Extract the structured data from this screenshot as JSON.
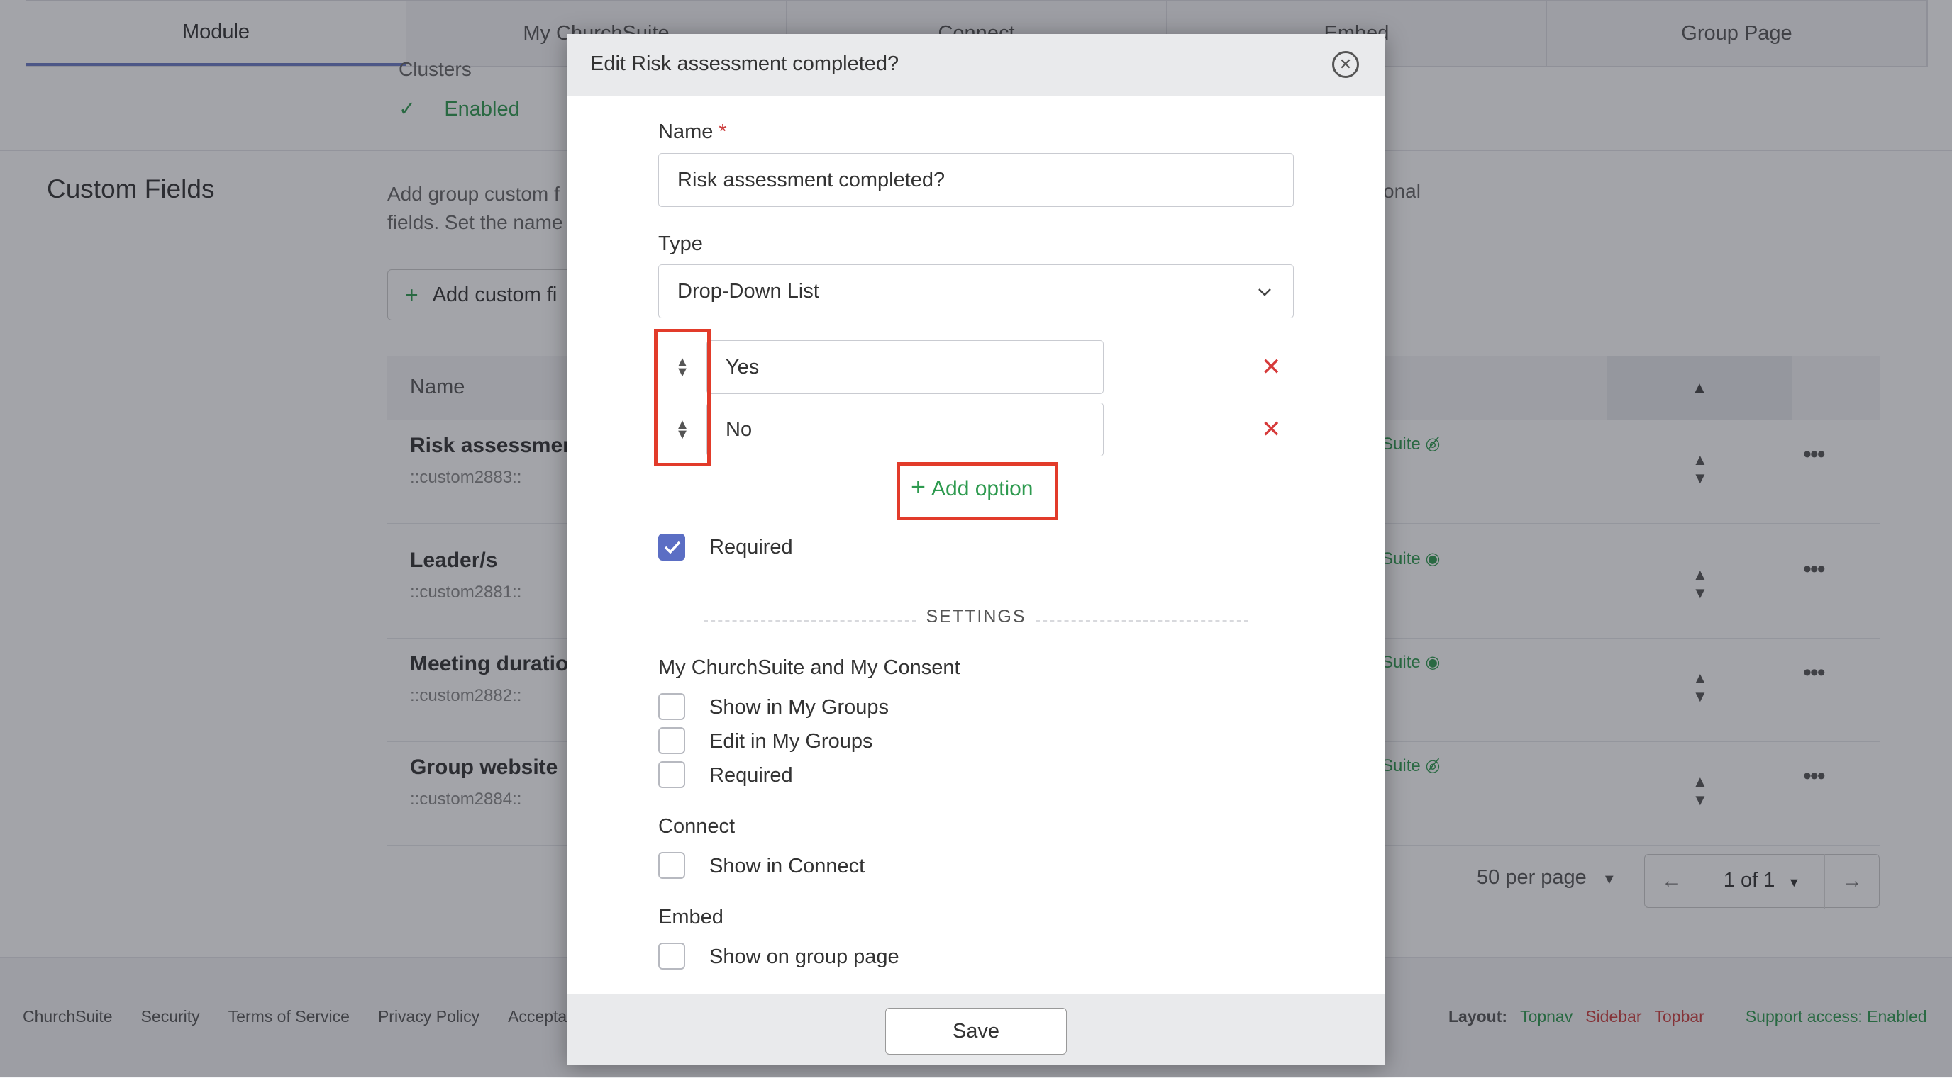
{
  "background": {
    "tabs": [
      "Module",
      "My ChurchSuite",
      "Connect",
      "Embed",
      "Group Page"
    ],
    "clusters": {
      "label": "Clusters",
      "value": "Enabled"
    },
    "custom_fields": {
      "title": "Custom Fields",
      "description_left": "Add group custom f",
      "description_left2": "fields. Set the name",
      "description_right": "onal",
      "add_button": "Add custom fi",
      "table_header_name": "Name",
      "rows": [
        {
          "name": "Risk assessment c",
          "code": "::custom2883::",
          "visibility": "Suite",
          "eye": "hidden"
        },
        {
          "name": "Leader/s",
          "code": "::custom2881::",
          "visibility": "Suite",
          "eye": "visible"
        },
        {
          "name": "Meeting duratio",
          "code": "::custom2882::",
          "visibility": "Suite",
          "eye": "visible"
        },
        {
          "name": "Group website",
          "code": "::custom2884::",
          "visibility": "Suite",
          "eye": "hidden"
        }
      ],
      "per_page": "50 per page",
      "pagination": "1 of 1"
    },
    "footer": {
      "links": [
        "ChurchSuite",
        "Security",
        "Terms of Service",
        "Privacy Policy",
        "Accepta"
      ],
      "layout_label": "Layout:",
      "layout_options": [
        {
          "label": "Topnav",
          "color": "#2e9a4f"
        },
        {
          "label": "Sidebar",
          "color": "#cc3d3d"
        },
        {
          "label": "Topbar",
          "color": "#cc3d3d"
        }
      ],
      "support_access": "Support access: Enabled"
    }
  },
  "modal": {
    "title": "Edit Risk assessment completed?",
    "name_label": "Name",
    "required_marker": "*",
    "name_value": "Risk assessment completed?",
    "type_label": "Type",
    "type_value": "Drop-Down List",
    "options": [
      "Yes",
      "No"
    ],
    "add_option_label": "Add option",
    "required_label": "Required",
    "required_checked": true,
    "settings_heading": "SETTINGS",
    "groups": [
      {
        "title": "My ChurchSuite and My Consent",
        "items": [
          {
            "label": "Show in My Groups",
            "checked": false
          },
          {
            "label": "Edit in My Groups",
            "checked": false
          },
          {
            "label": "Required",
            "checked": false
          }
        ]
      },
      {
        "title": "Connect",
        "items": [
          {
            "label": "Show in Connect",
            "checked": false
          }
        ]
      },
      {
        "title": "Embed",
        "items": [
          {
            "label": "Show on group page",
            "checked": false
          }
        ]
      }
    ],
    "save_label": "Save"
  },
  "colors": {
    "accent_green": "#2e9a4f",
    "danger_red": "#d63a3a",
    "highlight_red": "#e23b2a",
    "checkbox_blue": "#5b6ec4"
  }
}
